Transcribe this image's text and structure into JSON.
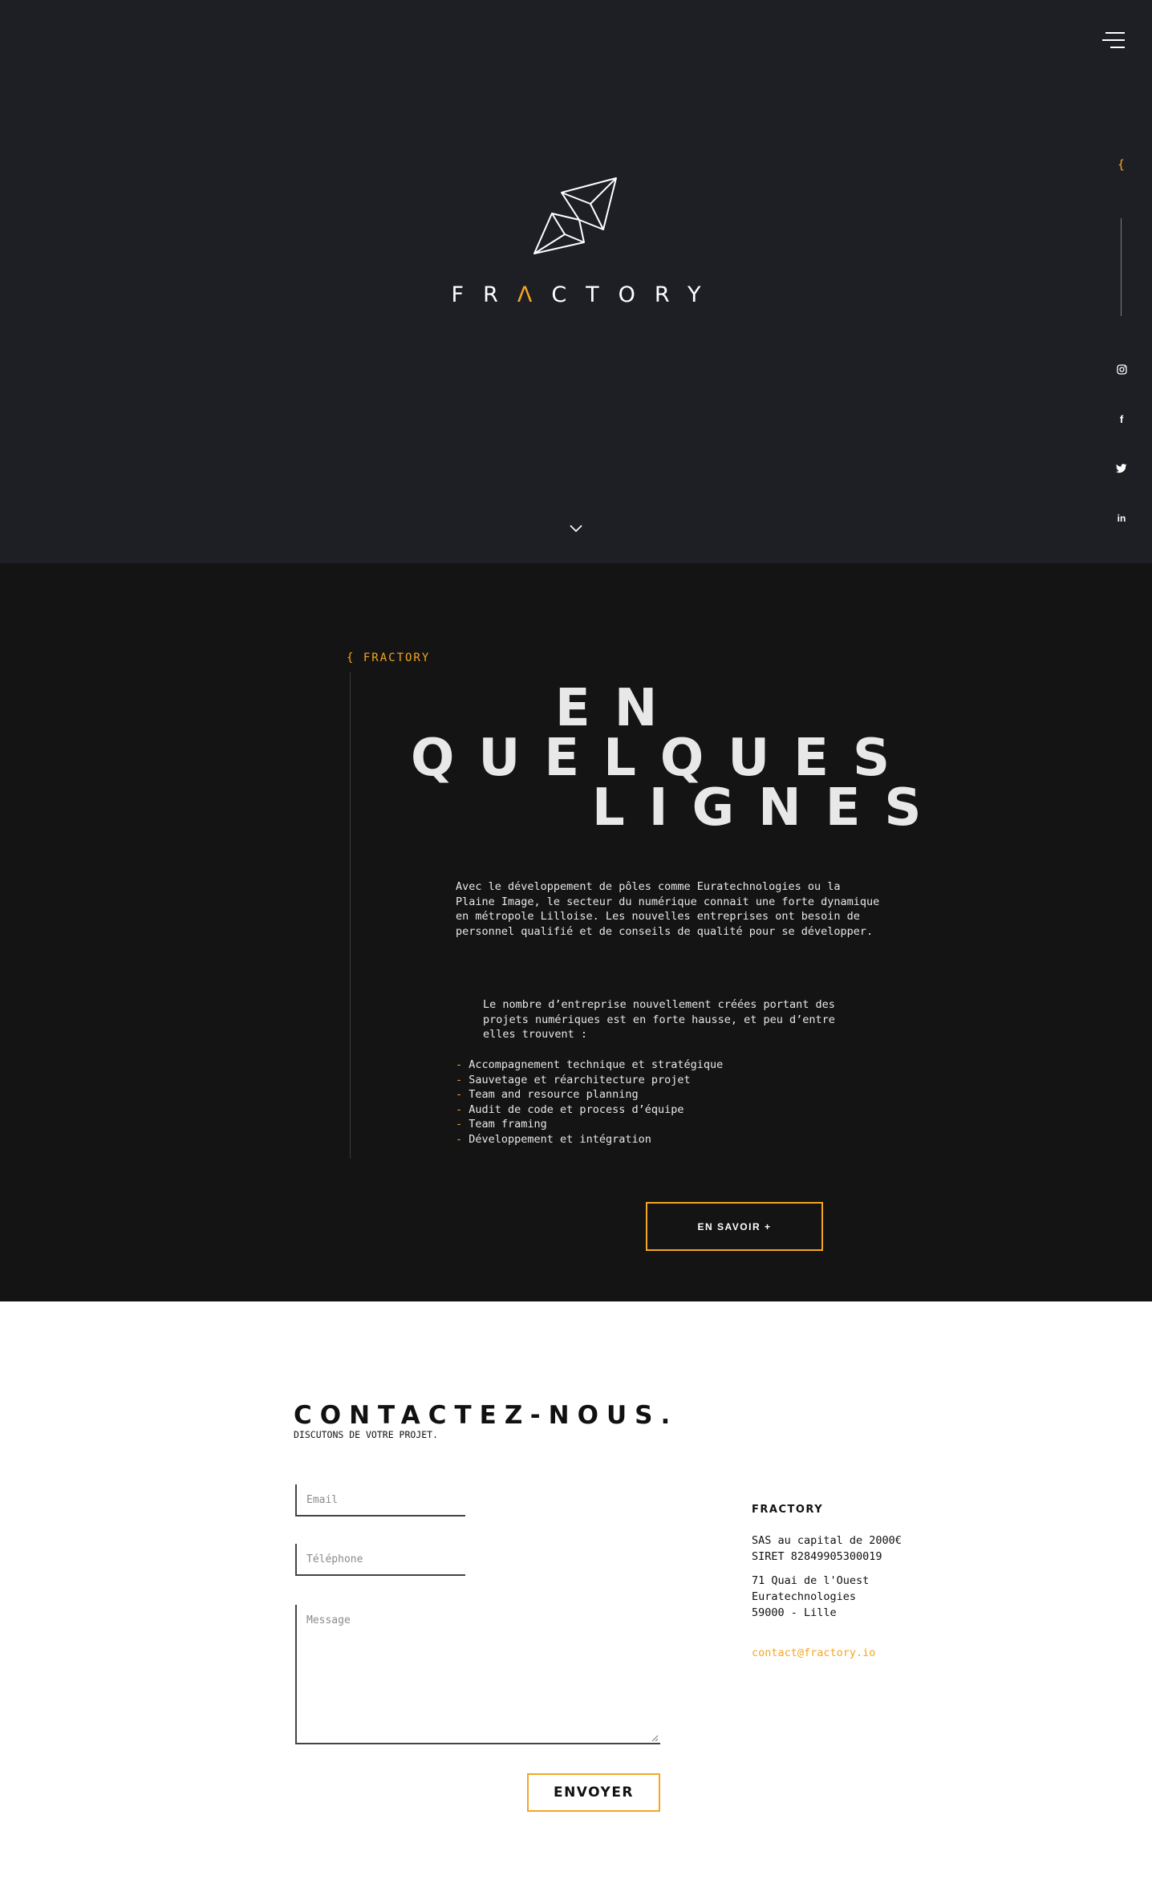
{
  "hero": {
    "wordmark_before": "FR",
    "wordmark_accent": "Λ",
    "wordmark_after": "CTORY",
    "side_brace": "{",
    "social": [
      "instagram-icon",
      "facebook-icon",
      "twitter-icon",
      "linkedin-icon"
    ],
    "social_labels": {
      "facebook": "f",
      "linkedin": "in"
    }
  },
  "about": {
    "kicker": "{ FRACTORY",
    "title_lines": [
      "EN",
      "QUELQUES",
      "LIGNES"
    ],
    "paragraph1": "Avec le développement de pôles comme Euratechnologies ou la Plaine Image, le secteur du numérique connait une forte dynamique en métropole Lilloise. Les nouvelles entreprises ont besoin de personnel qualifié et de conseils de qualité pour se développer.",
    "paragraph2": "Le nombre d’entreprise nouvellement créées portant des projets numériques est en forte hausse, et peu d’entre elles trouvent :",
    "list": [
      "Accompagnement technique et stratégique",
      "Sauvetage et réarchitecture projet",
      "Team and resource planning",
      "Audit de code et process d’équipe",
      "Team framing",
      "Développement et intégration"
    ],
    "button_label": "EN SAVOIR +"
  },
  "contact": {
    "title": "CONTACTEZ-NOUS.",
    "subtitle": "DISCUTONS DE VOTRE PROJET.",
    "email_placeholder": "Email",
    "phone_placeholder": "Téléphone",
    "message_placeholder": "Message",
    "send_label": "ENVOYER",
    "company": {
      "name": "FRACTORY",
      "legal_line1": "SAS au capital de 2000€",
      "legal_line2": "SIRET 82849905300019",
      "address_line1": "71 Quai de l'Ouest",
      "address_line2": "Euratechnologies",
      "address_line3": "59000 - Lille",
      "email": "contact@fractory.io"
    }
  },
  "colors": {
    "hero_bg": "#1e1f25",
    "about_bg": "#141414",
    "accent": "#f5a623",
    "text_light": "#e8e8e8",
    "text_dark": "#111111"
  }
}
